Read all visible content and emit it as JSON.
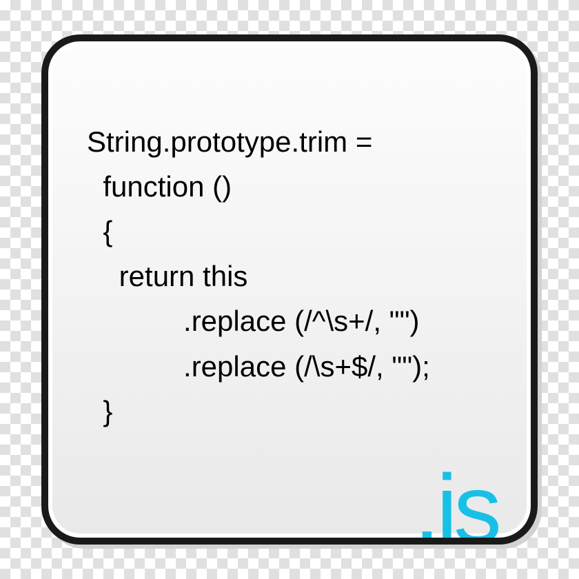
{
  "code": {
    "line1": "String.prototype.trim =",
    "line2": "  function ()",
    "line3": "  {",
    "line4": "    return this",
    "line5": "            .replace (/^\\s+/, \"\")",
    "line6": "            .replace (/\\s+$/, \"\");",
    "line7": "  }"
  },
  "extension": ".js"
}
